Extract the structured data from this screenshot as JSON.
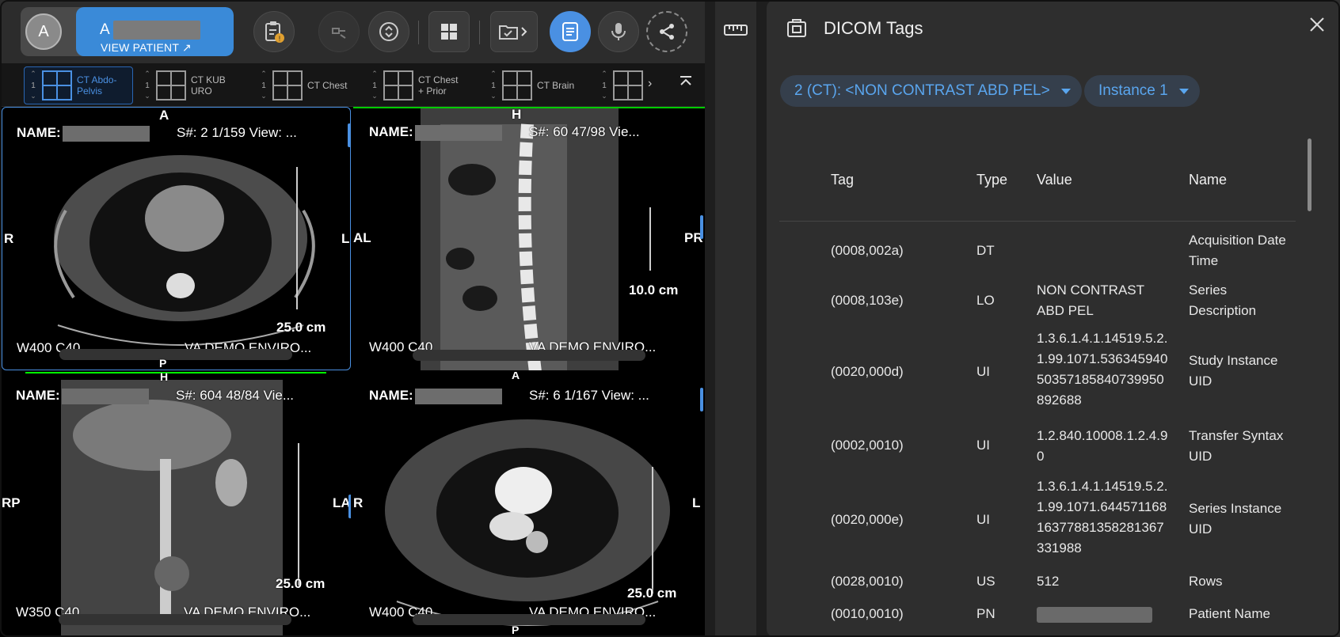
{
  "patient": {
    "avatar_initial": "A",
    "name_initial": "A",
    "view_patient_label": "VIEW PATIENT ↗"
  },
  "toolbar": {
    "icons": [
      "clipboard-alert-icon",
      "plug-icon",
      "sort-icon",
      "grid-icon",
      "folder-check-icon",
      "notes-icon",
      "mic-icon",
      "share-icon"
    ]
  },
  "layouts": [
    {
      "count": "1",
      "label": "CT Abdo-\nPelvis",
      "selected": true
    },
    {
      "count": "1",
      "label": "CT KUB\nURO",
      "selected": false
    },
    {
      "count": "1",
      "label": "CT Chest",
      "selected": false
    },
    {
      "count": "1",
      "label": "CT Chest\n+ Prior",
      "selected": false
    },
    {
      "count": "1",
      "label": "CT Brain",
      "selected": false
    },
    {
      "count": "1",
      "label": "",
      "selected": false
    }
  ],
  "viewports": [
    {
      "name_label": "NAME:",
      "series": "S#: 2  1/159  View: ...",
      "top": "A",
      "bottom": "P",
      "left": "R",
      "right": "L",
      "scale": "25.0 cm",
      "window": "W400 C40",
      "site": "VA DEMO ENVIRO..."
    },
    {
      "name_label": "NAME:",
      "series": "S#: 60   47/98  Vie...",
      "top": "H",
      "bottom": "",
      "left": "AL",
      "right": "PR",
      "scale": "10.0 cm",
      "window": "W400 C40",
      "site": "VA DEMO ENVIRO..."
    },
    {
      "name_label": "NAME:",
      "series": "S#: 604  48/84  Vie...",
      "top": "H",
      "bottom": "",
      "left": "RP",
      "right": "LA",
      "scale": "25.0 cm",
      "window": "W350 C40",
      "site": "VA DEMO ENVIRO..."
    },
    {
      "name_label": "NAME:",
      "series": "S#: 6  1/167  View: ...",
      "top": "A",
      "bottom": "P",
      "left": "R",
      "right": "L",
      "scale": "25.0 cm",
      "window": "W400 C40",
      "site": "VA DEMO ENVIRO..."
    }
  ],
  "panel": {
    "title": "DICOM Tags",
    "series_select": "2 (CT): <NON CONTRAST ABD PEL>",
    "instance_select": "Instance 1",
    "columns": {
      "tag": "Tag",
      "type": "Type",
      "value": "Value",
      "name": "Name"
    },
    "rows": [
      {
        "tag": "(0008,002a)",
        "type": "DT",
        "value": "",
        "name": "Acquisition Date Time"
      },
      {
        "tag": "(0008,103e)",
        "type": "LO",
        "value": "NON CONTRAST ABD PEL",
        "name": "Series Description"
      },
      {
        "tag": "(0020,000d)",
        "type": "UI",
        "value": "1.3.6.1.4.1.14519.5.2.1.99.1071.53634594050357185840739950892688",
        "name": "Study Instance UID"
      },
      {
        "tag": "(0002,0010)",
        "type": "UI",
        "value": "1.2.840.10008.1.2.4.90",
        "name": "Transfer Syntax UID"
      },
      {
        "tag": "(0020,000e)",
        "type": "UI",
        "value": "1.3.6.1.4.1.14519.5.2.1.99.1071.64457116816377881358281367331988",
        "name": "Series Instance UID"
      },
      {
        "tag": "(0028,0010)",
        "type": "US",
        "value": "512",
        "name": "Rows"
      },
      {
        "tag": "(0010,0010)",
        "type": "PN",
        "value": "",
        "name": "Patient Name"
      }
    ]
  }
}
